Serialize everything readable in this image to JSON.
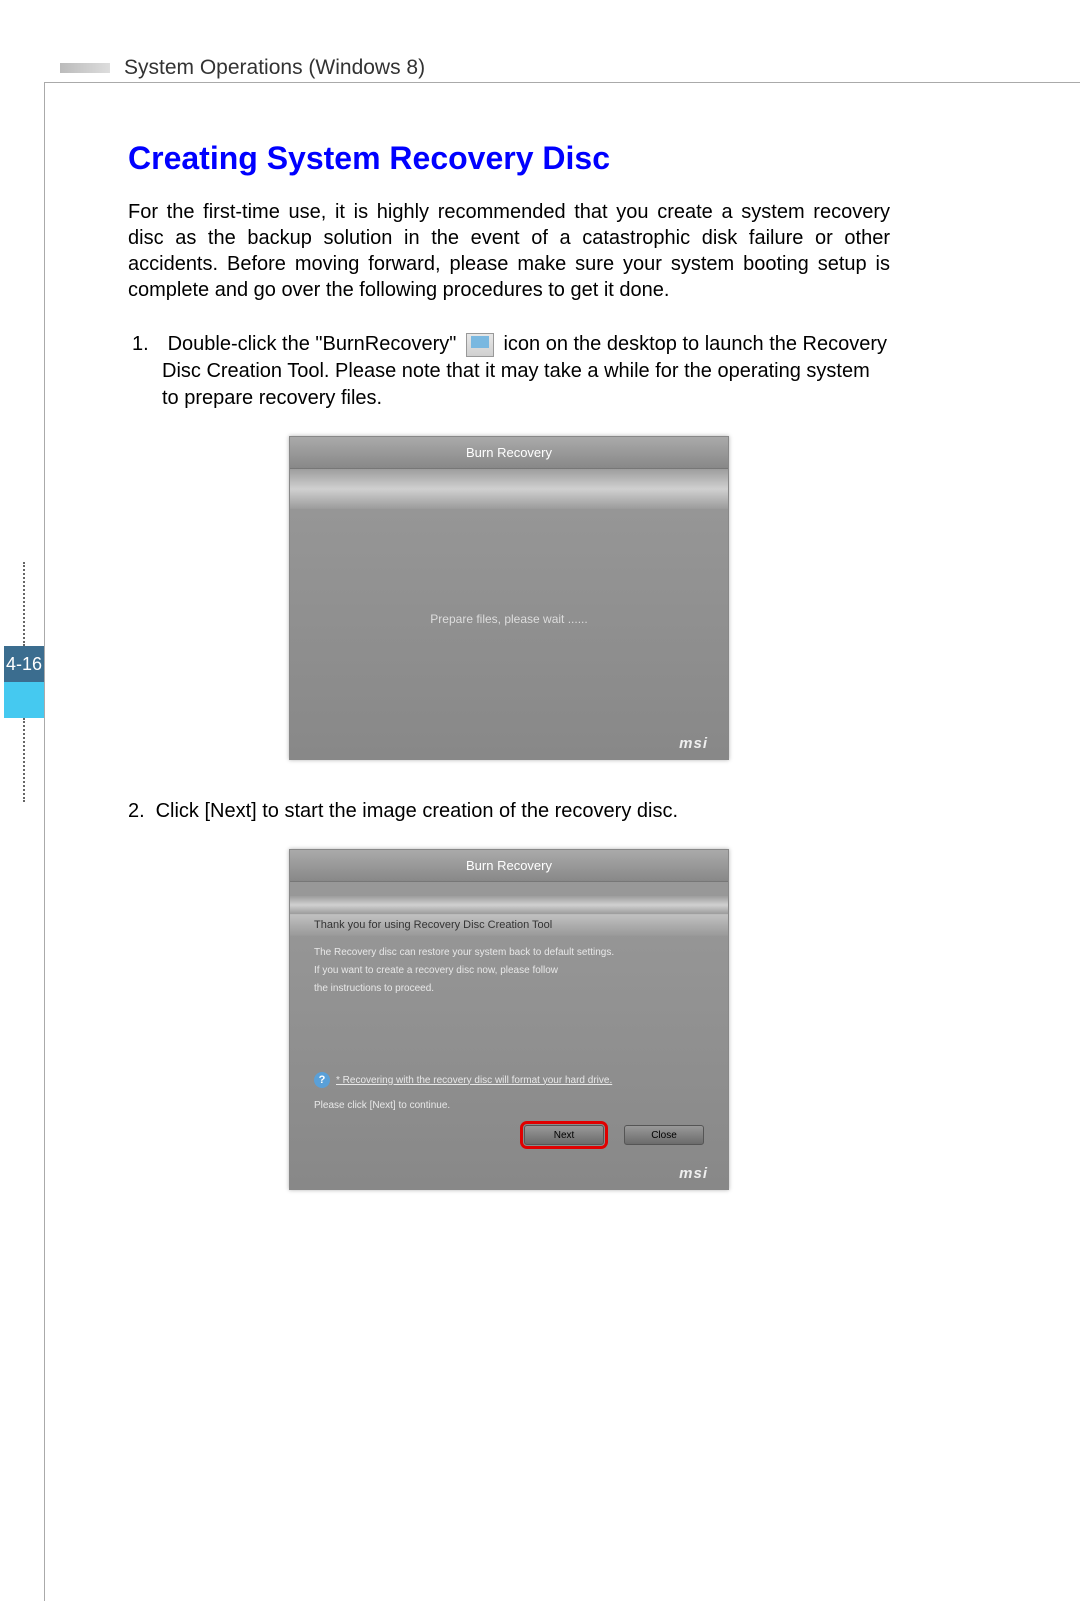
{
  "header": {
    "section_title": "System Operations (Windows 8)"
  },
  "page": {
    "number": "4-16",
    "title": "Creating System Recovery Disc",
    "intro": "For the first-time use, it is highly recommended that you create a system recovery disc as the backup solution in the event of a catastrophic disk failure or other accidents. Before moving forward, please make sure your system booting setup is complete and go over the following procedures to get it done."
  },
  "steps": {
    "s1_num": "1.",
    "s1_a": "Double-click the \"BurnRecovery\"",
    "s1_b": "icon on the desktop to launch the Recovery Disc Creation Tool. Please note that it may take a while for the operating system to prepare recovery files.",
    "s2_num": "2.",
    "s2": "Click [Next] to start the image creation of the recovery disc."
  },
  "screenshot1": {
    "title": "Burn Recovery",
    "message": "Prepare files, please wait ......",
    "brand": "msi"
  },
  "screenshot2": {
    "title": "Burn Recovery",
    "subtitle": "Thank you for using Recovery Disc Creation Tool",
    "line1": "The Recovery disc can restore your system back to default settings.",
    "line2": "If you want to create a recovery disc now, please follow",
    "line3": "the instructions to proceed.",
    "note": "* Recovering with the recovery disc will format your hard drive.",
    "continue_text": "Please click [Next] to continue.",
    "next_label": "Next",
    "close_label": "Close",
    "brand": "msi"
  }
}
